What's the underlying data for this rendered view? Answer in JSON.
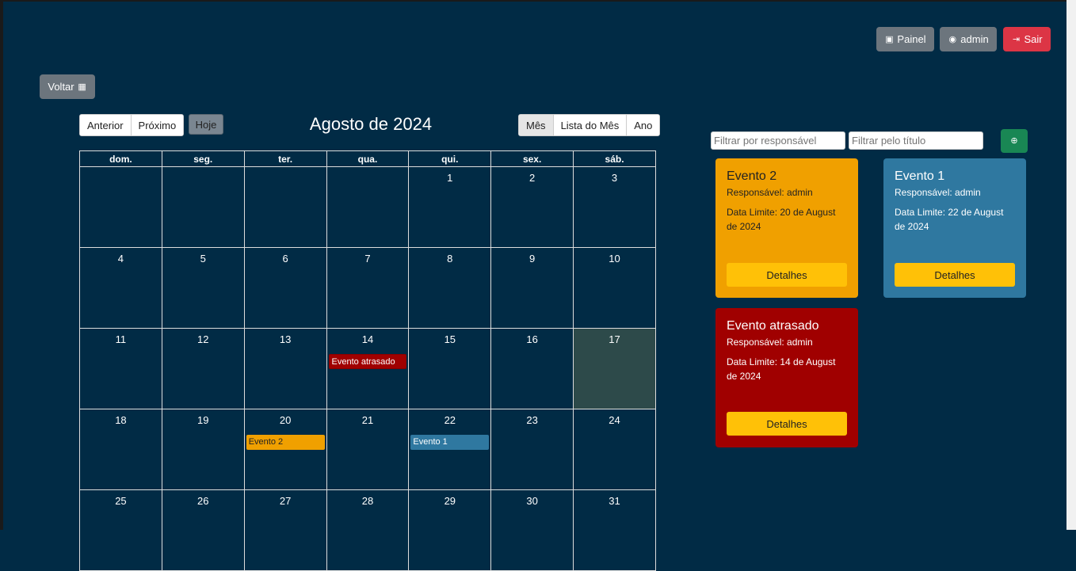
{
  "header": {
    "panel_label": "Painel",
    "user_label": "admin",
    "logout_label": "Sair",
    "back_label": "Voltar"
  },
  "calendar": {
    "title": "Agosto de 2024",
    "nav": {
      "prev": "Anterior",
      "next": "Próximo",
      "today": "Hoje"
    },
    "views": {
      "month": "Mês",
      "list": "Lista do Mês",
      "year": "Ano",
      "active": "Mês"
    },
    "weekdays": [
      "dom.",
      "seg.",
      "ter.",
      "qua.",
      "qui.",
      "sex.",
      "sáb."
    ],
    "weeks": [
      [
        "",
        "",
        "",
        "",
        "1",
        "2",
        "3"
      ],
      [
        "4",
        "5",
        "6",
        "7",
        "8",
        "9",
        "10"
      ],
      [
        "11",
        "12",
        "13",
        "14",
        "15",
        "16",
        "17"
      ],
      [
        "18",
        "19",
        "20",
        "21",
        "22",
        "23",
        "24"
      ],
      [
        "25",
        "26",
        "27",
        "28",
        "29",
        "30",
        "31"
      ]
    ],
    "today": "17",
    "events": [
      {
        "day": "14",
        "title": "Evento atrasado",
        "color": "#a00000"
      },
      {
        "day": "20",
        "title": "Evento 2",
        "color": "#f0a000"
      },
      {
        "day": "22",
        "title": "Evento 1",
        "color": "#2f78a0"
      }
    ]
  },
  "filters": {
    "responsible_placeholder": "Filtrar por responsável",
    "title_placeholder": "Filtrar pelo título"
  },
  "cards": [
    {
      "title": "Evento 2",
      "responsible": "Responsável: admin",
      "deadline": "Data Limite: 20 de August de 2024",
      "button": "Detalhes",
      "color": "#f0a000"
    },
    {
      "title": "Evento 1",
      "responsible": "Responsável: admin",
      "deadline": "Data Limite: 22 de August de 2024",
      "button": "Detalhes",
      "color": "#2f78a0"
    },
    {
      "title": "Evento atrasado",
      "responsible": "Responsável: admin",
      "deadline": "Data Limite: 14 de August de 2024",
      "button": "Detalhes",
      "color": "#a00000"
    }
  ],
  "colors": {
    "background": "#012b45",
    "button_accent": "#ffc107",
    "danger": "#dc3545",
    "success": "#198754"
  }
}
